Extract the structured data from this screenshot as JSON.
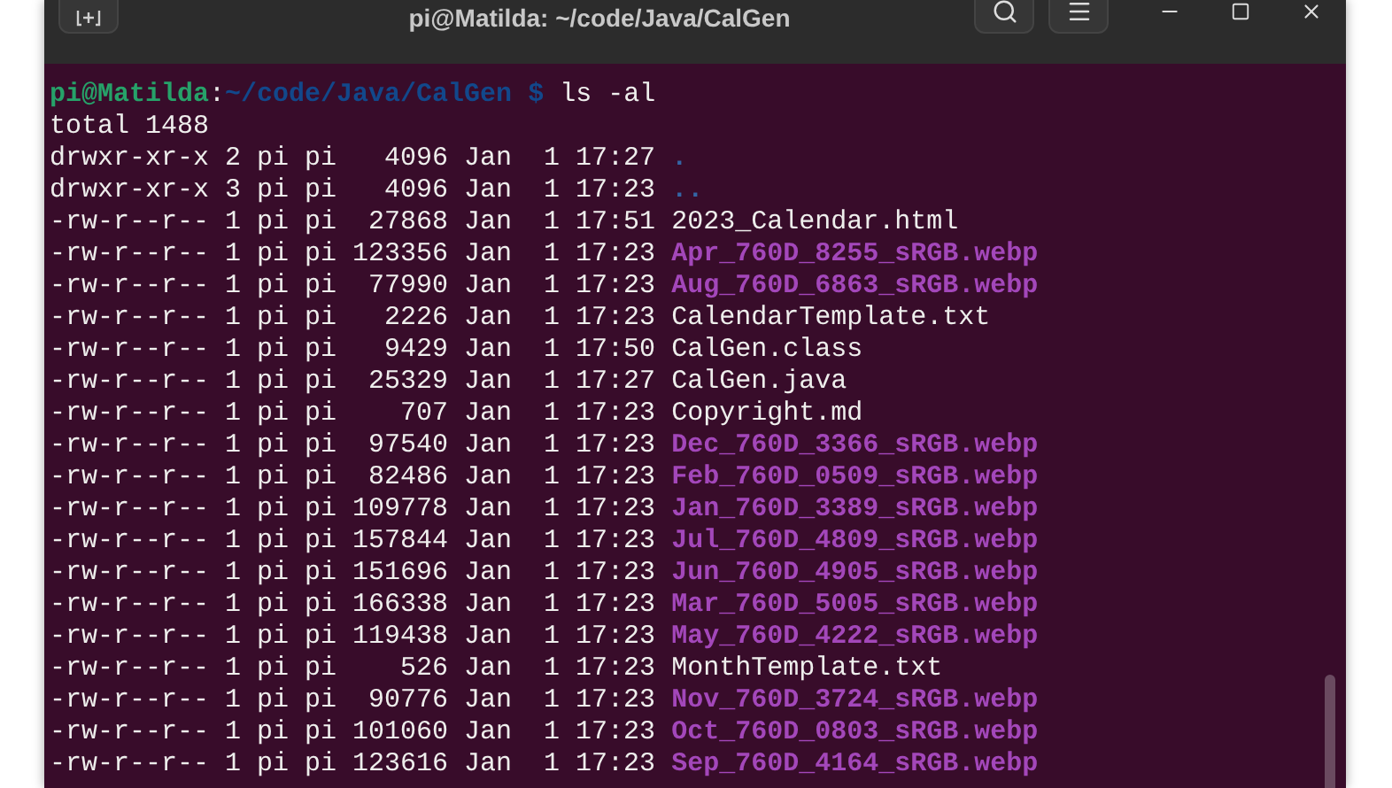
{
  "window": {
    "title": "pi@Matilda: ~/code/Java/CalGen"
  },
  "prompt": {
    "user_host": "pi@Matilda",
    "separator": ":",
    "path": "~/code/Java/CalGen",
    "symbol": "$",
    "command": "ls -al"
  },
  "output_header": "total 1488",
  "entries": [
    {
      "info": "drwxr-xr-x 2 pi pi   4096 Jan  1 17:27",
      "name": ".",
      "kind": "dir"
    },
    {
      "info": "drwxr-xr-x 3 pi pi   4096 Jan  1 17:23",
      "name": "..",
      "kind": "dir"
    },
    {
      "info": "-rw-r--r-- 1 pi pi  27868 Jan  1 17:51",
      "name": "2023_Calendar.html",
      "kind": "file"
    },
    {
      "info": "-rw-r--r-- 1 pi pi 123356 Jan  1 17:23",
      "name": "Apr_760D_8255_sRGB.webp",
      "kind": "image"
    },
    {
      "info": "-rw-r--r-- 1 pi pi  77990 Jan  1 17:23",
      "name": "Aug_760D_6863_sRGB.webp",
      "kind": "image"
    },
    {
      "info": "-rw-r--r-- 1 pi pi   2226 Jan  1 17:23",
      "name": "CalendarTemplate.txt",
      "kind": "file"
    },
    {
      "info": "-rw-r--r-- 1 pi pi   9429 Jan  1 17:50",
      "name": "CalGen.class",
      "kind": "file"
    },
    {
      "info": "-rw-r--r-- 1 pi pi  25329 Jan  1 17:27",
      "name": "CalGen.java",
      "kind": "file"
    },
    {
      "info": "-rw-r--r-- 1 pi pi    707 Jan  1 17:23",
      "name": "Copyright.md",
      "kind": "file"
    },
    {
      "info": "-rw-r--r-- 1 pi pi  97540 Jan  1 17:23",
      "name": "Dec_760D_3366_sRGB.webp",
      "kind": "image"
    },
    {
      "info": "-rw-r--r-- 1 pi pi  82486 Jan  1 17:23",
      "name": "Feb_760D_0509_sRGB.webp",
      "kind": "image"
    },
    {
      "info": "-rw-r--r-- 1 pi pi 109778 Jan  1 17:23",
      "name": "Jan_760D_3389_sRGB.webp",
      "kind": "image"
    },
    {
      "info": "-rw-r--r-- 1 pi pi 157844 Jan  1 17:23",
      "name": "Jul_760D_4809_sRGB.webp",
      "kind": "image"
    },
    {
      "info": "-rw-r--r-- 1 pi pi 151696 Jan  1 17:23",
      "name": "Jun_760D_4905_sRGB.webp",
      "kind": "image"
    },
    {
      "info": "-rw-r--r-- 1 pi pi 166338 Jan  1 17:23",
      "name": "Mar_760D_5005_sRGB.webp",
      "kind": "image"
    },
    {
      "info": "-rw-r--r-- 1 pi pi 119438 Jan  1 17:23",
      "name": "May_760D_4222_sRGB.webp",
      "kind": "image"
    },
    {
      "info": "-rw-r--r-- 1 pi pi    526 Jan  1 17:23",
      "name": "MonthTemplate.txt",
      "kind": "file"
    },
    {
      "info": "-rw-r--r-- 1 pi pi  90776 Jan  1 17:23",
      "name": "Nov_760D_3724_sRGB.webp",
      "kind": "image"
    },
    {
      "info": "-rw-r--r-- 1 pi pi 101060 Jan  1 17:23",
      "name": "Oct_760D_0803_sRGB.webp",
      "kind": "image"
    },
    {
      "info": "-rw-r--r-- 1 pi pi 123616 Jan  1 17:23",
      "name": "Sep_760D_4164_sRGB.webp",
      "kind": "image"
    }
  ]
}
